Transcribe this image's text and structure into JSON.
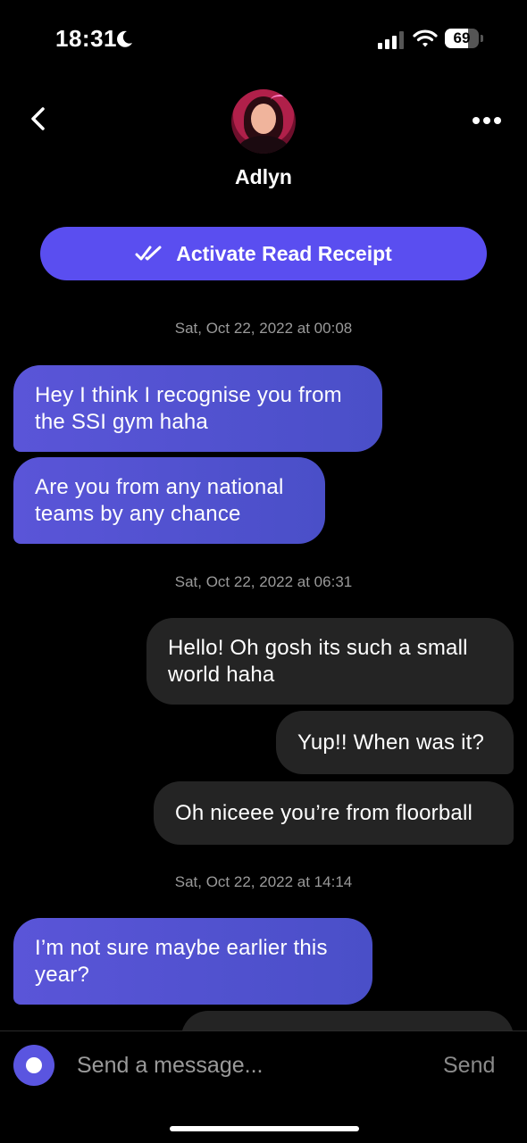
{
  "status_bar": {
    "time": "18:31",
    "battery": "69",
    "battery_level_percent": 69,
    "icons": [
      "moon-icon",
      "signal-icon",
      "wifi-icon",
      "battery-icon"
    ]
  },
  "header": {
    "back_icon": "chevron-left-icon",
    "more_icon": "more-horizontal-icon",
    "contact_name": "Adlyn"
  },
  "read_receipt": {
    "label": "Activate Read Receipt",
    "icon": "double-check-icon"
  },
  "colors": {
    "accent": "#5a4ef0",
    "incoming_bubble": "#5155d0",
    "outgoing_bubble": "#242424",
    "background": "#000000"
  },
  "conversation": [
    {
      "type": "timestamp",
      "text": "Sat, Oct 22, 2022 at 00:08"
    },
    {
      "type": "incoming",
      "text": "Hey I think I recognise you from the SSI gym haha"
    },
    {
      "type": "incoming",
      "text": "Are you from any national teams by any chance"
    },
    {
      "type": "timestamp",
      "text": "Sat, Oct 22, 2022 at 06:31"
    },
    {
      "type": "outgoing",
      "text": "Hello! Oh gosh its such a small world haha"
    },
    {
      "type": "outgoing",
      "text": "Yup!! When was it?"
    },
    {
      "type": "outgoing",
      "text": "Oh niceee you’re from floorball"
    },
    {
      "type": "timestamp",
      "text": "Sat, Oct 22, 2022 at 14:14"
    },
    {
      "type": "incoming",
      "text": "I’m not sure maybe earlier this year?"
    }
  ],
  "composer": {
    "placeholder": "Send a message...",
    "send_label": "Send"
  }
}
